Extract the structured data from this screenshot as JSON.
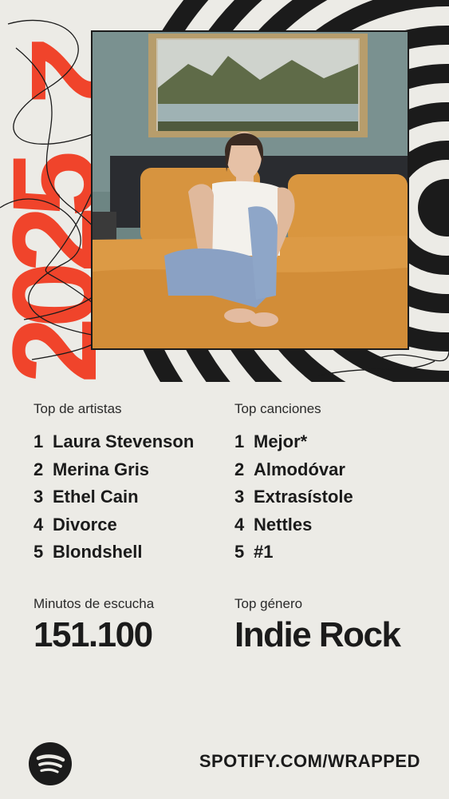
{
  "year": "2025",
  "top_artists": {
    "label": "Top de artistas",
    "items": [
      {
        "rank": "1",
        "name": "Laura Stevenson"
      },
      {
        "rank": "2",
        "name": "Merina Gris"
      },
      {
        "rank": "3",
        "name": "Ethel Cain"
      },
      {
        "rank": "4",
        "name": "Divorce"
      },
      {
        "rank": "5",
        "name": "Blondshell"
      }
    ]
  },
  "top_songs": {
    "label": "Top canciones",
    "items": [
      {
        "rank": "1",
        "name": "Mejor*"
      },
      {
        "rank": "2",
        "name": "Almodóvar"
      },
      {
        "rank": "3",
        "name": "Extrasístole"
      },
      {
        "rank": "4",
        "name": "Nettles"
      },
      {
        "rank": "5",
        "name": "#1"
      }
    ]
  },
  "minutes": {
    "label": "Minutos de escucha",
    "value": "151.100"
  },
  "genre": {
    "label": "Top género",
    "value": "Indie Rock"
  },
  "footer": {
    "url": "SPOTIFY.COM/WRAPPED",
    "logo_icon": "spotify-logo-icon"
  },
  "colors": {
    "background": "#ecebe6",
    "accent_red": "#f0442b",
    "text": "#1b1b1b"
  }
}
